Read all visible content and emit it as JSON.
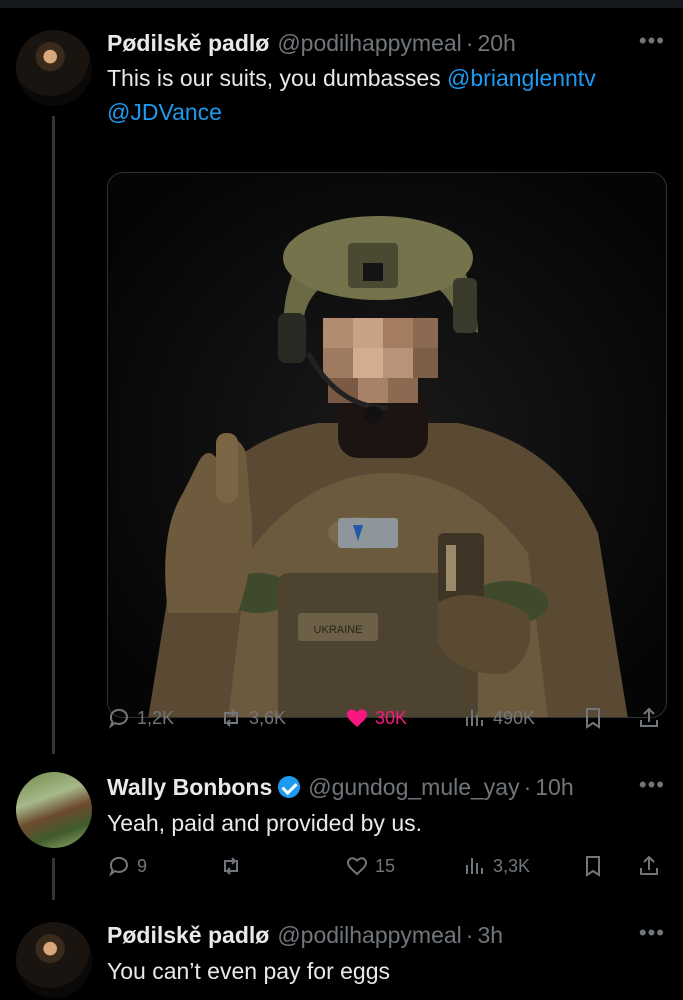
{
  "tweets": [
    {
      "author": "Pødilskě padlø",
      "handle": "@podilhappymeal",
      "separator": "·",
      "time": "20h",
      "more": "•••",
      "text": "This is our suits, you dumbasses ",
      "mentions": [
        "@brianglenntv",
        "@JDVance"
      ],
      "media_patch_text": "UKRAINE",
      "stats": {
        "replies": "1,2K",
        "retweets": "3,6K",
        "likes": "30K",
        "views": "490K"
      },
      "liked": true
    },
    {
      "author": "Wally Bonbons",
      "handle": "@gundog_mule_yay",
      "separator": "·",
      "time": "10h",
      "more": "•••",
      "verified": true,
      "text": "Yeah, paid and provided by us.",
      "stats": {
        "replies": "9",
        "retweets": "",
        "likes": "15",
        "views": "3,3K"
      },
      "liked": false
    },
    {
      "author": "Pødilskě padlø",
      "handle": "@podilhappymeal",
      "separator": "·",
      "time": "3h",
      "more": "•••",
      "text": "You can’t even pay for eggs"
    }
  ],
  "colors": {
    "accent": "#1d9bf0",
    "like": "#f91880",
    "muted": "#71767b",
    "background": "#000000"
  },
  "icons": [
    "reply-icon",
    "retweet-icon",
    "like-icon",
    "views-icon",
    "bookmark-icon",
    "share-icon",
    "verified-icon",
    "more-icon"
  ]
}
